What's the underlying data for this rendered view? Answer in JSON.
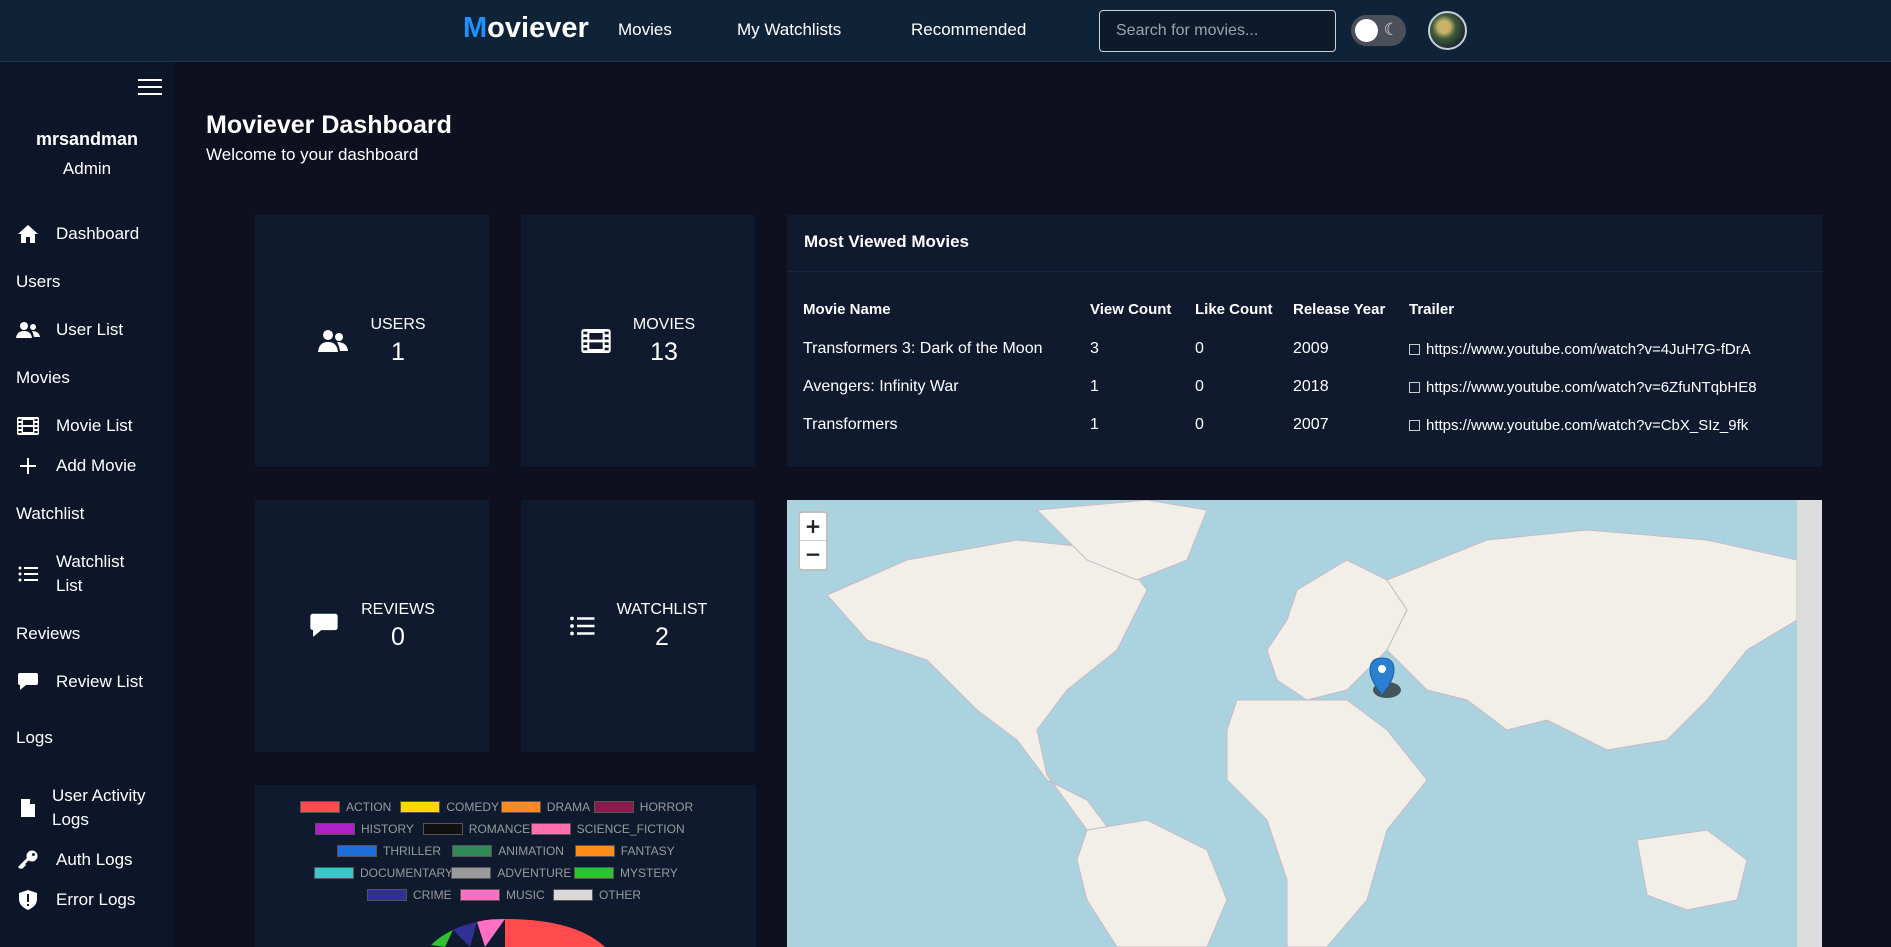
{
  "brand": {
    "first": "M",
    "rest": "oviever"
  },
  "nav": {
    "movies": "Movies",
    "watchlists": "My Watchlists",
    "recommended": "Recommended"
  },
  "search": {
    "placeholder": "Search for movies..."
  },
  "sidebar": {
    "username": "mrsandman",
    "role": "Admin",
    "dashboard": "Dashboard",
    "sec_users": "Users",
    "user_list": "User List",
    "sec_movies": "Movies",
    "movie_list": "Movie List",
    "add_movie": "Add Movie",
    "sec_watchlist": "Watchlist",
    "watchlist_list_1": "Watchlist",
    "watchlist_list_2": "List",
    "sec_reviews": "Reviews",
    "review_list": "Review List",
    "sec_logs": "Logs",
    "user_activity_1": "User Activity",
    "user_activity_2": "Logs",
    "auth_logs": "Auth Logs",
    "error_logs": "Error Logs"
  },
  "header": {
    "title": "Moviever Dashboard",
    "subtitle": "Welcome to your dashboard"
  },
  "stats": {
    "users": {
      "label": "USERS",
      "value": "1"
    },
    "movies": {
      "label": "MOVIES",
      "value": "13"
    },
    "reviews": {
      "label": "REVIEWS",
      "value": "0"
    },
    "watchlist": {
      "label": "WATCHLIST",
      "value": "2"
    }
  },
  "most_viewed": {
    "title": "Most Viewed Movies",
    "columns": [
      "Movie Name",
      "View Count",
      "Like Count",
      "Release Year",
      "Trailer"
    ],
    "rows": [
      [
        "Transformers 3: Dark of the Moon",
        "3",
        "0",
        "2009",
        "https://www.youtube.com/watch?v=4JuH7G-fDrA"
      ],
      [
        "Avengers: Infinity War",
        "1",
        "0",
        "2018",
        "https://www.youtube.com/watch?v=6ZfuNTqbHE8"
      ],
      [
        "Transformers",
        "1",
        "0",
        "2007",
        "https://www.youtube.com/watch?v=CbX_SIz_9fk"
      ]
    ]
  },
  "map": {
    "zoom_in": "+",
    "zoom_out": "−"
  },
  "genre_legend": [
    {
      "name": "ACTION",
      "color": "#ff4b4b"
    },
    {
      "name": "COMEDY",
      "color": "#ffd700"
    },
    {
      "name": "DRAMA",
      "color": "#ff8a1f"
    },
    {
      "name": "HORROR",
      "color": "#8b1a4a"
    },
    {
      "name": "HISTORY",
      "color": "#b020c8"
    },
    {
      "name": "ROMANCE",
      "color": "#111111"
    },
    {
      "name": "SCIENCE_FICTION",
      "color": "#ff6fae"
    },
    {
      "name": "THRILLER",
      "color": "#1e6fdc"
    },
    {
      "name": "ANIMATION",
      "color": "#2e8b57"
    },
    {
      "name": "FANTASY",
      "color": "#ff8c1a"
    },
    {
      "name": "DOCUMENTARY",
      "color": "#40c4cc"
    },
    {
      "name": "ADVENTURE",
      "color": "#9a9a9a"
    },
    {
      "name": "MYSTERY",
      "color": "#2fc12f"
    },
    {
      "name": "CRIME",
      "color": "#303095"
    },
    {
      "name": "MUSIC",
      "color": "#ff6fc2"
    },
    {
      "name": "OTHER",
      "color": "#d9d9d9"
    }
  ]
}
